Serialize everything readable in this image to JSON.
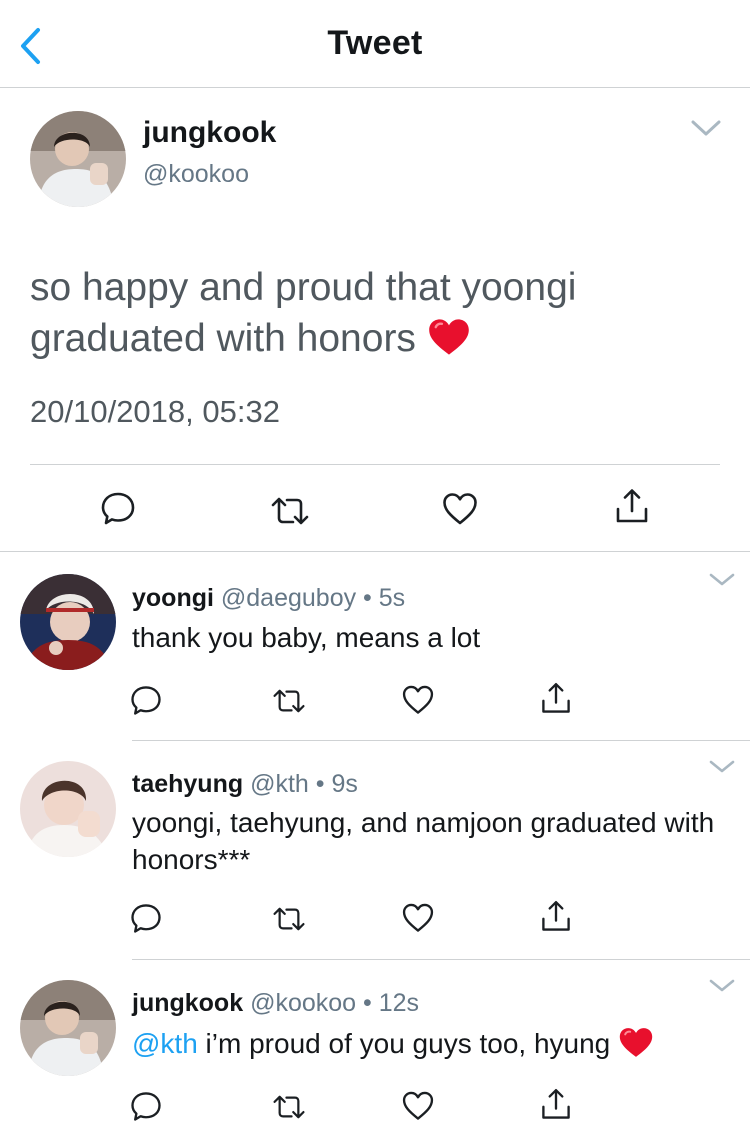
{
  "nav": {
    "title": "Tweet"
  },
  "main_tweet": {
    "name": "jungkook",
    "handle": "@kookoo",
    "text": "so happy and proud that yoongi graduated with honors",
    "emoji": "red-heart",
    "timestamp": "20/10/2018, 05:32"
  },
  "replies": [
    {
      "name": "yoongi",
      "meta": "@daeguboy • 5s",
      "mention": "",
      "text": "thank you baby, means a lot"
    },
    {
      "name": "taehyung",
      "meta": "@kth • 9s",
      "mention": "",
      "text": "yoongi, taehyung, and namjoon graduated with honors***"
    },
    {
      "name": "jungkook",
      "meta": "@kookoo • 12s",
      "mention": "@kth",
      "text": " i’m proud of you guys too, hyung",
      "emoji": "red-heart"
    }
  ],
  "icons": [
    "chevron-left-icon",
    "chevron-down-icon",
    "reply-icon",
    "retweet-icon",
    "like-icon",
    "share-icon"
  ],
  "colors": {
    "accent": "#1da1f2",
    "text": "#14171a",
    "secondary": "#657786",
    "divider": "#cfd2d4",
    "heart": "#e8102d"
  }
}
